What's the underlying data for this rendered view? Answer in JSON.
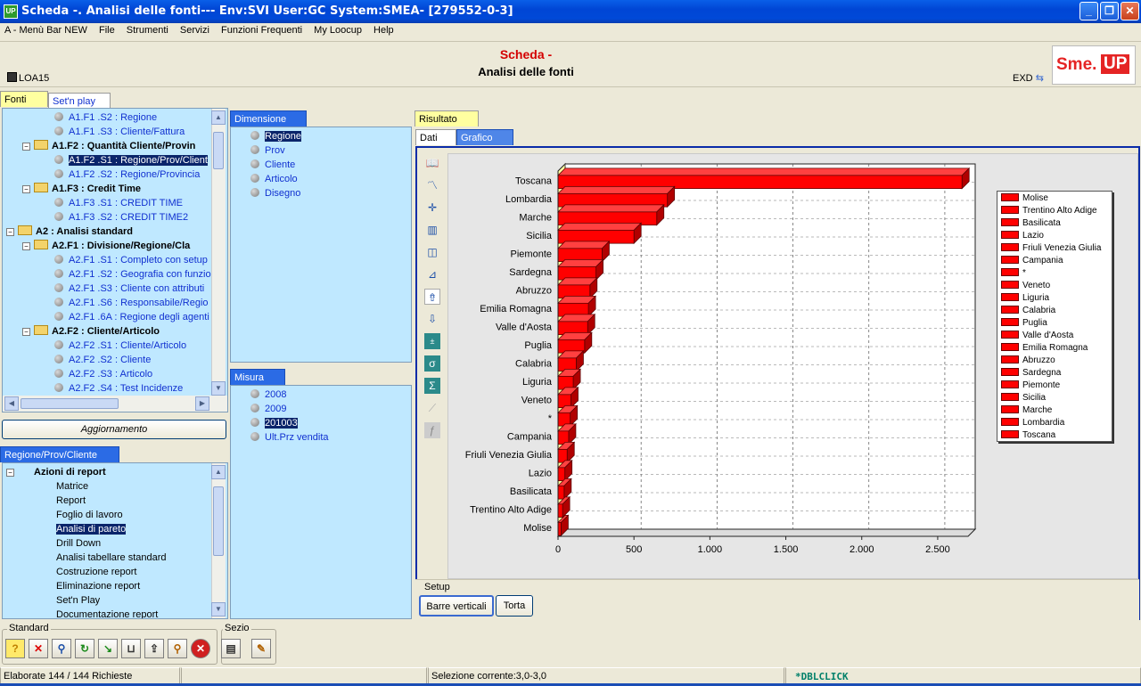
{
  "window": {
    "title": "Scheda -. Analisi delle fonti--- Env:SVI User:GC System:SMEA- [279552-0-3]",
    "app_icon": "UP"
  },
  "menu": [
    "A - Menù Bar NEW",
    "File",
    "Strumenti",
    "Servizi",
    "Funzioni Frequenti",
    "My Loocup",
    "Help"
  ],
  "header": {
    "title1": "Scheda -",
    "title2": "Analisi delle fonti",
    "left_code": "LOA15",
    "right_code": "EXD",
    "logo_a": "Sme.",
    "logo_b": "UP"
  },
  "left_tabs": {
    "fonti": "Fonti",
    "setnplay": "Set'n play"
  },
  "fonti_tree": [
    {
      "text": "A1.F1 .S2 : Regione",
      "level": 3
    },
    {
      "text": "A1.F1 .S3 : Cliente/Fattura",
      "level": 3
    },
    {
      "text": "A1.F2 : Quantità Cliente/Provin",
      "level": 2
    },
    {
      "text": "A1.F2 .S1 : Regione/Prov/Client",
      "level": 3
    },
    {
      "text": "A1.F2 .S2 : Regione/Provincia",
      "level": 3
    },
    {
      "text": "A1.F3 : Credit Time",
      "level": 2
    },
    {
      "text": "A1.F3 .S1 : CREDIT TIME",
      "level": 3
    },
    {
      "text": "A1.F3 .S2 : CREDIT TIME2",
      "level": 3
    },
    {
      "text": "A2 : Analisi standard",
      "level": 1
    },
    {
      "text": "A2.F1 : Divisione/Regione/Cla",
      "level": 2
    },
    {
      "text": "A2.F1 .S1 : Completo con setup",
      "level": 3
    },
    {
      "text": "A2.F1 .S2 : Geografia con funzio",
      "level": 3
    },
    {
      "text": "A2.F1 .S3 : Cliente con attributi",
      "level": 3
    },
    {
      "text": "A2.F1 .S6 : Responsabile/Regio",
      "level": 3
    },
    {
      "text": "A2.F1 .6A : Regione degli agenti",
      "level": 3
    },
    {
      "text": "A2.F2 : Cliente/Articolo",
      "level": 2
    },
    {
      "text": "A2.F2 .S1 : Cliente/Articolo",
      "level": 3
    },
    {
      "text": "A2.F2 .S2 : Cliente",
      "level": 3
    },
    {
      "text": "A2.F2 .S3 : Articolo",
      "level": 3
    },
    {
      "text": "A2.F2 .S4 : Test Incidenze",
      "level": 3
    }
  ],
  "aggiornamento_label": "Aggiornamento",
  "actions_tab": "Regione/Prov/Cliente",
  "actions_tree": {
    "root": "Azioni di report",
    "items": [
      "Matrice",
      "Report",
      "Foglio di lavoro",
      "Analisi di pareto",
      "Drill Down",
      "Analisi tabellare standard",
      "Costruzione report",
      "Eliminazione report",
      "Set'n Play",
      "Documentazione report"
    ],
    "selected": "Analisi di pareto"
  },
  "dimensione": {
    "tab": "Dimensione",
    "items": [
      "Regione",
      "Prov",
      "Cliente",
      "Articolo",
      "Disegno"
    ],
    "selected": "Regione"
  },
  "misura": {
    "tab": "Misura",
    "items": [
      "2008",
      "2009",
      "201003",
      "Ult.Prz vendita"
    ],
    "selected": "201003"
  },
  "risultato": {
    "tab": "Risultato",
    "subtab_dati": "Dati",
    "subtab_grafico": "Grafico"
  },
  "setup": {
    "label": "Setup",
    "btn_barre": "Barre verticali",
    "btn_torta": "Torta"
  },
  "toolbar_groups": {
    "standard": "Standard",
    "sezio": "Sezio"
  },
  "status": {
    "left": "Elaborate 144 / 144 Richieste",
    "middle": "Selezione corrente:3,0-3,0",
    "right": "*DBLCLICK"
  },
  "chart_data": {
    "type": "bar",
    "orientation": "horizontal",
    "categories": [
      "Toscana",
      "Lombardia",
      "Marche",
      "Sicilia",
      "Piemonte",
      "Sardegna",
      "Abruzzo",
      "Emilia Romagna",
      "Valle d'Aosta",
      "Puglia",
      "Calabria",
      "Liguria",
      "Veneto",
      "*",
      "Campania",
      "Friuli Venezia Giulia",
      "Lazio",
      "Basilicata",
      "Trentino Alto Adige",
      "Molise"
    ],
    "values": [
      2660,
      720,
      650,
      500,
      290,
      250,
      210,
      200,
      195,
      175,
      120,
      100,
      85,
      80,
      70,
      60,
      45,
      40,
      30,
      20
    ],
    "xticks": [
      "0",
      "500",
      "1.000",
      "1.500",
      "2.000",
      "2.500"
    ],
    "xlim": [
      0,
      2700
    ],
    "grid": true,
    "legend_position": "right",
    "legend": [
      "Molise",
      "Trentino Alto Adige",
      "Basilicata",
      "Lazio",
      "Friuli Venezia Giulia",
      "Campania",
      "*",
      "Veneto",
      "Liguria",
      "Calabria",
      "Puglia",
      "Valle d'Aosta",
      "Emilia Romagna",
      "Abruzzo",
      "Sardegna",
      "Piemonte",
      "Sicilia",
      "Marche",
      "Lombardia",
      "Toscana"
    ],
    "bar_color": "#FF0000"
  }
}
